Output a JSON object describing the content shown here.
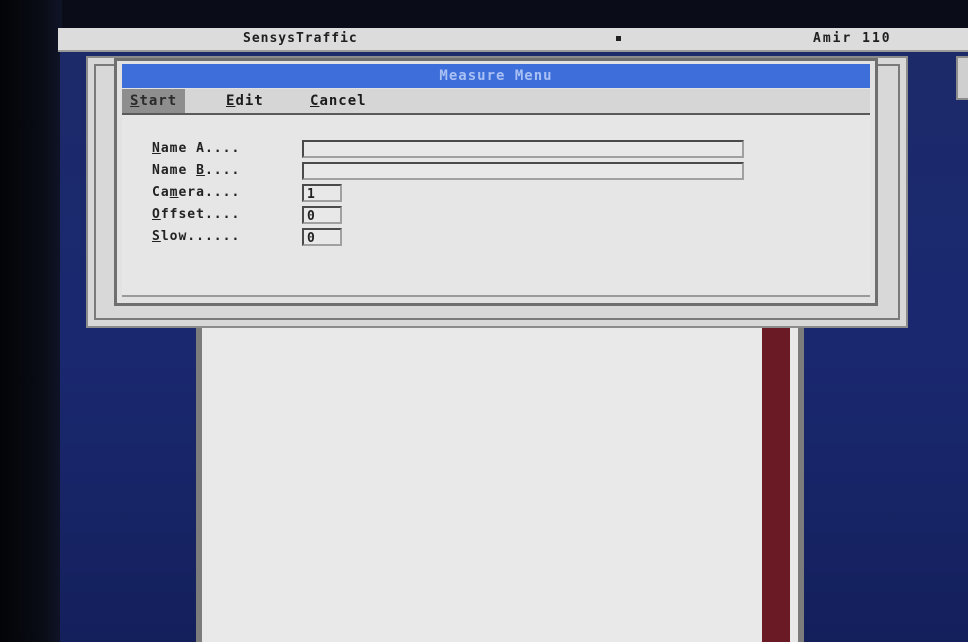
{
  "status_bar": {
    "app_title": "SensysTraffic",
    "user": "Amir 110"
  },
  "dialog": {
    "title": "Measure Menu",
    "menu": [
      {
        "accel": "S",
        "rest": "tart"
      },
      {
        "accel": "E",
        "rest": "dit"
      },
      {
        "accel": "C",
        "rest": "ancel"
      }
    ],
    "fields": [
      {
        "pre": "",
        "accel": "N",
        "post": "ame A....",
        "value": ""
      },
      {
        "pre": "Name ",
        "accel": "B",
        "post": "....",
        "value": ""
      },
      {
        "pre": "Ca",
        "accel": "m",
        "post": "era....",
        "value": "1"
      },
      {
        "pre": "",
        "accel": "O",
        "post": "ffset....",
        "value": "0"
      },
      {
        "pre": "",
        "accel": "S",
        "post": "low......",
        "value": "0"
      }
    ]
  },
  "colors": {
    "title_bar": "#3d6ed9",
    "desktop": "#1c2a6a",
    "document_strip": "#6a1a24"
  }
}
